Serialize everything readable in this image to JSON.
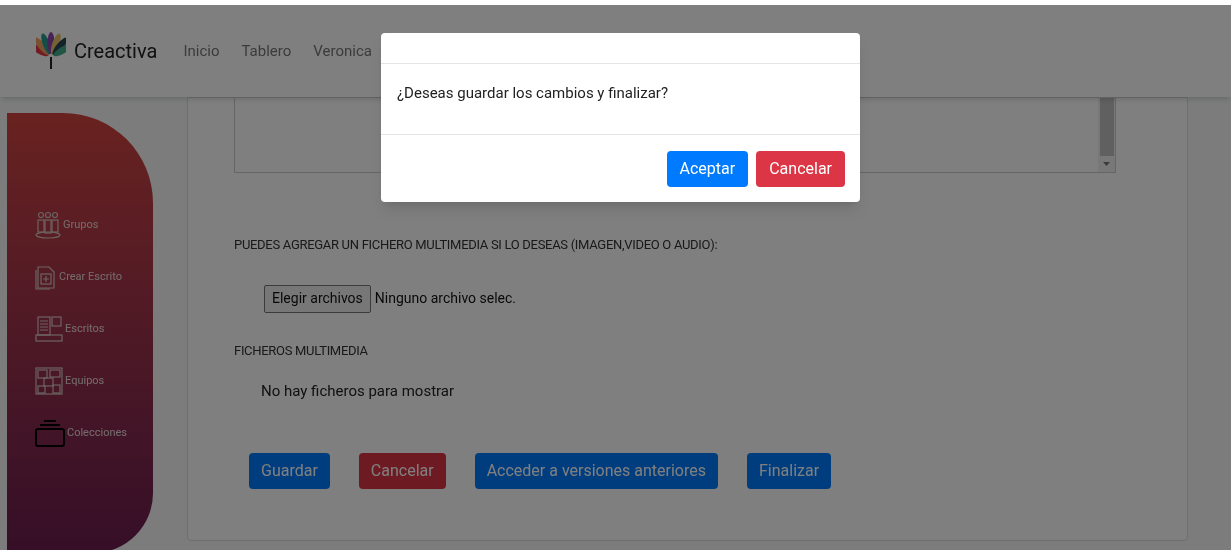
{
  "navbar": {
    "brand": "Creactiva",
    "links": [
      "Inicio",
      "Tablero",
      "Veronica"
    ]
  },
  "sidebar": {
    "items": [
      {
        "label": "Grupos",
        "kind": "groups"
      },
      {
        "label": "Crear Escrito",
        "kind": "new-doc"
      },
      {
        "label": "Escritos",
        "kind": "docs"
      },
      {
        "label": "Equipos",
        "kind": "teams"
      },
      {
        "label": "Colecciones",
        "kind": "collections"
      }
    ]
  },
  "form": {
    "upload_label": "PUEDES AGREGAR UN FICHERO MULTIMEDIA SI LO DESEAS (IMAGEN,VIDEO O AUDIO):",
    "file_button": "Elegir archivos",
    "file_status": "Ninguno archivo selec.",
    "media_heading": "FICHEROS MULTIMEDIA",
    "media_empty": "No hay ficheros para mostrar",
    "buttons": [
      {
        "label": "Guardar",
        "kind": "primary"
      },
      {
        "label": "Cancelar",
        "kind": "danger"
      },
      {
        "label": "Acceder a versiones anteriores",
        "kind": "primary"
      },
      {
        "label": "Finalizar",
        "kind": "primary"
      }
    ]
  },
  "dialog": {
    "message": "¿Deseas guardar los cambios y finalizar?",
    "buttons": [
      {
        "label": "Aceptar",
        "kind": "primary"
      },
      {
        "label": "Cancelar",
        "kind": "danger"
      }
    ]
  }
}
